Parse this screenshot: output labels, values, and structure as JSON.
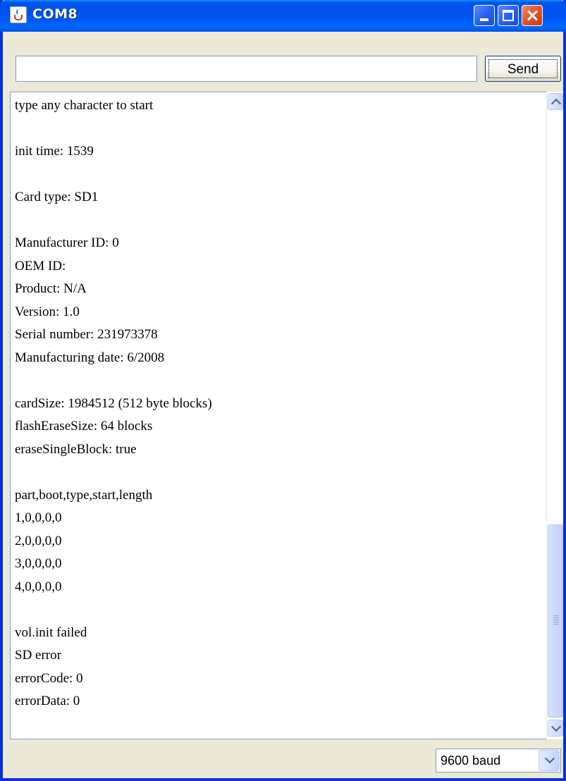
{
  "window": {
    "title": "COM8"
  },
  "input": {
    "value": "",
    "placeholder": ""
  },
  "send_button": {
    "label": "Send"
  },
  "console": {
    "lines": [
      "type any character to start",
      "",
      "init time: 1539",
      "",
      "Card type: SD1",
      "",
      "Manufacturer ID: 0",
      "OEM ID:",
      "Product: N/A",
      "Version: 1.0",
      "Serial number: 231973378",
      "Manufacturing date: 6/2008",
      "",
      "cardSize: 1984512 (512 byte blocks)",
      "flashEraseSize: 64 blocks",
      "eraseSingleBlock: true",
      "",
      "part,boot,type,start,length",
      "1,0,0,0,0",
      "2,0,0,0,0",
      "3,0,0,0,0",
      "4,0,0,0,0",
      "",
      "vol.init failed",
      "SD error",
      "errorCode: 0",
      "errorData: 0"
    ]
  },
  "status_bar": {
    "baud": "9600 baud"
  },
  "icons": {
    "app": "java-cup-icon",
    "minimize": "minimize-icon",
    "maximize": "maximize-icon",
    "close": "close-icon",
    "scroll_up": "chevron-up-icon",
    "scroll_down": "chevron-down-icon",
    "dropdown": "chevron-down-icon"
  },
  "colors": {
    "titlebar": "#0054e3",
    "frame": "#0831d9",
    "close_button": "#e2532b",
    "background": "#ece9d8"
  }
}
